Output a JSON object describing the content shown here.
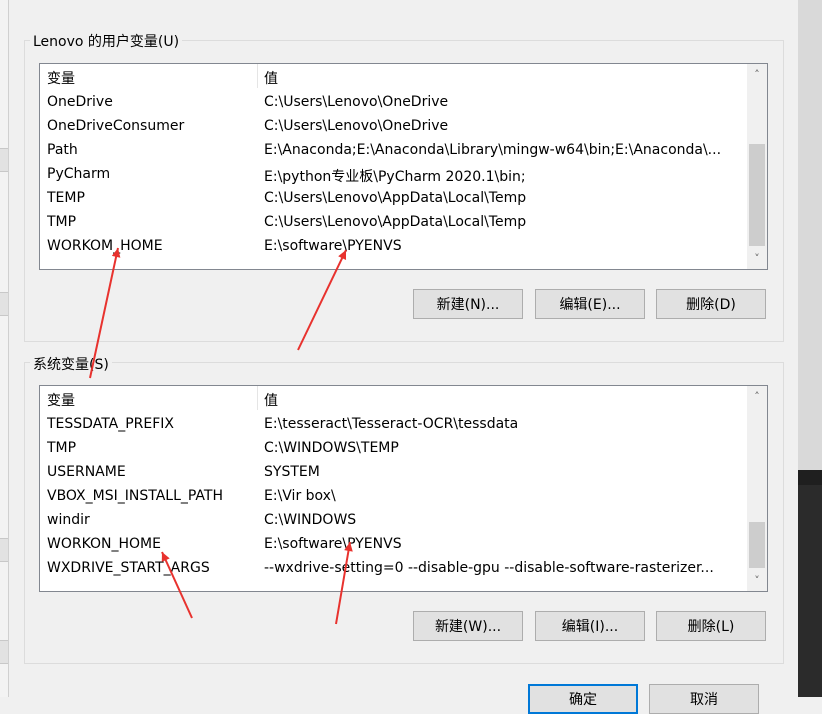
{
  "user_vars": {
    "group_title": "Lenovo 的用户变量(U)",
    "header": {
      "name": "变量",
      "value": "值"
    },
    "rows": [
      {
        "name": "OneDrive",
        "value": "C:\\Users\\Lenovo\\OneDrive"
      },
      {
        "name": "OneDriveConsumer",
        "value": "C:\\Users\\Lenovo\\OneDrive"
      },
      {
        "name": "Path",
        "value": "E:\\Anaconda;E:\\Anaconda\\Library\\mingw-w64\\bin;E:\\Anaconda\\..."
      },
      {
        "name": "PyCharm",
        "value": "E:\\python专业板\\PyCharm 2020.1\\bin;"
      },
      {
        "name": "TEMP",
        "value": "C:\\Users\\Lenovo\\AppData\\Local\\Temp"
      },
      {
        "name": "TMP",
        "value": "C:\\Users\\Lenovo\\AppData\\Local\\Temp"
      },
      {
        "name": "WORKOM_HOME",
        "value": "E:\\software\\PYENVS"
      }
    ],
    "buttons": {
      "new": "新建(N)...",
      "edit": "编辑(E)...",
      "delete": "删除(D)"
    }
  },
  "system_vars": {
    "group_title": "系统变量(S)",
    "header": {
      "name": "变量",
      "value": "值"
    },
    "rows": [
      {
        "name": "TESSDATA_PREFIX",
        "value": "E:\\tesseract\\Tesseract-OCR\\tessdata"
      },
      {
        "name": "TMP",
        "value": "C:\\WINDOWS\\TEMP"
      },
      {
        "name": "USERNAME",
        "value": "SYSTEM"
      },
      {
        "name": "VBOX_MSI_INSTALL_PATH",
        "value": "E:\\Vir box\\"
      },
      {
        "name": "windir",
        "value": "C:\\WINDOWS"
      },
      {
        "name": "WORKON_HOME",
        "value": "E:\\software\\PYENVS"
      },
      {
        "name": "WXDRIVE_START_ARGS",
        "value": "--wxdrive-setting=0 --disable-gpu --disable-software-rasterizer..."
      }
    ],
    "buttons": {
      "new": "新建(W)...",
      "edit": "编辑(I)...",
      "delete": "删除(L)"
    }
  },
  "dialog_buttons": {
    "ok": "确定",
    "cancel": "取消"
  },
  "annotation_color": "#e8322e",
  "icons": {
    "scroll_up": "chevron-up-icon",
    "scroll_down": "chevron-down-icon"
  }
}
